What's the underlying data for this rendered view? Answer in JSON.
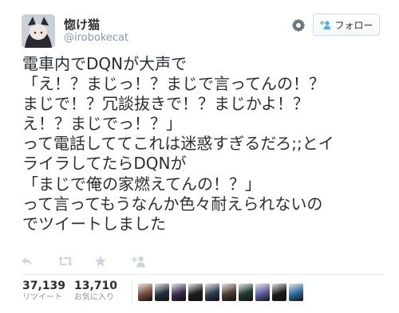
{
  "user": {
    "name": "惚け猫",
    "handle": "@irobokecat"
  },
  "header": {
    "follow_label": "フォロー"
  },
  "tweet": {
    "lines": [
      "電車内でDQNが大声で",
      "「え！？まじっ！？まじで言ってんの！？",
      "まじで！？冗談抜きで！？まじかよ！？",
      "え！？まじでっ！？」",
      "って電話しててこれは迷惑すぎるだろ;;とイ",
      "ライラしてたらDQNが",
      "「まじで俺の家燃えてんの！？」",
      "って言ってもうなんか色々耐えられないの",
      "でツイートしました"
    ]
  },
  "stats": {
    "retweets": {
      "count": "37,139",
      "label": "リツイート"
    },
    "favorites": {
      "count": "13,710",
      "label": "お気に入り"
    }
  },
  "favoriters": {
    "colors": [
      "#7a4a3a",
      "#24303c",
      "#3a2a4a",
      "#1c1c1c",
      "#2e3a50",
      "#4a3a30",
      "#1f3a2a",
      "#5a5aa0",
      "#1a1a1a",
      "#2a6a9a"
    ]
  },
  "icons": [
    "gear-icon",
    "follow-person-plus-icon",
    "reply-icon",
    "retweet-icon",
    "favorite-star-icon",
    "follow-person-plus-icon"
  ]
}
